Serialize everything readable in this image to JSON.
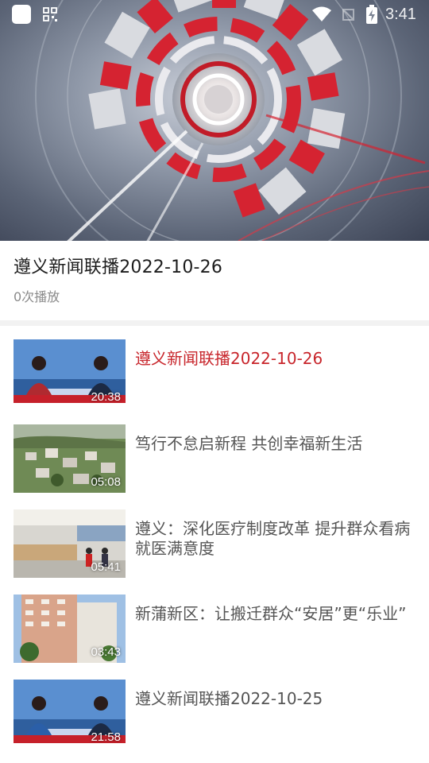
{
  "status_bar": {
    "time": "3:41",
    "icons": [
      "app-square-icon",
      "qr-grid-icon",
      "wifi-icon",
      "signal-off-icon",
      "battery-charging-icon"
    ]
  },
  "player": {
    "poster": "news-program-intro-graphic"
  },
  "current": {
    "title": "遵义新闻联播2022-10-26",
    "plays": "0次播放"
  },
  "colors": {
    "accent": "#c8262c",
    "title": "#1c1c1c",
    "item_text": "#555555",
    "muted": "#8a8a8a",
    "divider": "#f2f2f2"
  },
  "playlist": [
    {
      "title": "遵义新闻联播2022-10-26",
      "duration": "20:38",
      "active": true,
      "thumb": "anchors-studio"
    },
    {
      "title": "笃行不怠启新程 共创幸福新生活",
      "duration": "05:08",
      "active": false,
      "thumb": "village-aerial"
    },
    {
      "title": "遵义：深化医疗制度改革 提升群众看病就医满意度",
      "duration": "05:41",
      "active": false,
      "thumb": "hospital-hall"
    },
    {
      "title": "新蒲新区：让搬迁群众“安居”更“乐业”",
      "duration": "03:43",
      "active": false,
      "thumb": "apartment-buildings"
    },
    {
      "title": "遵义新闻联播2022-10-25",
      "duration": "21:58",
      "active": false,
      "thumb": "anchors-studio"
    }
  ]
}
